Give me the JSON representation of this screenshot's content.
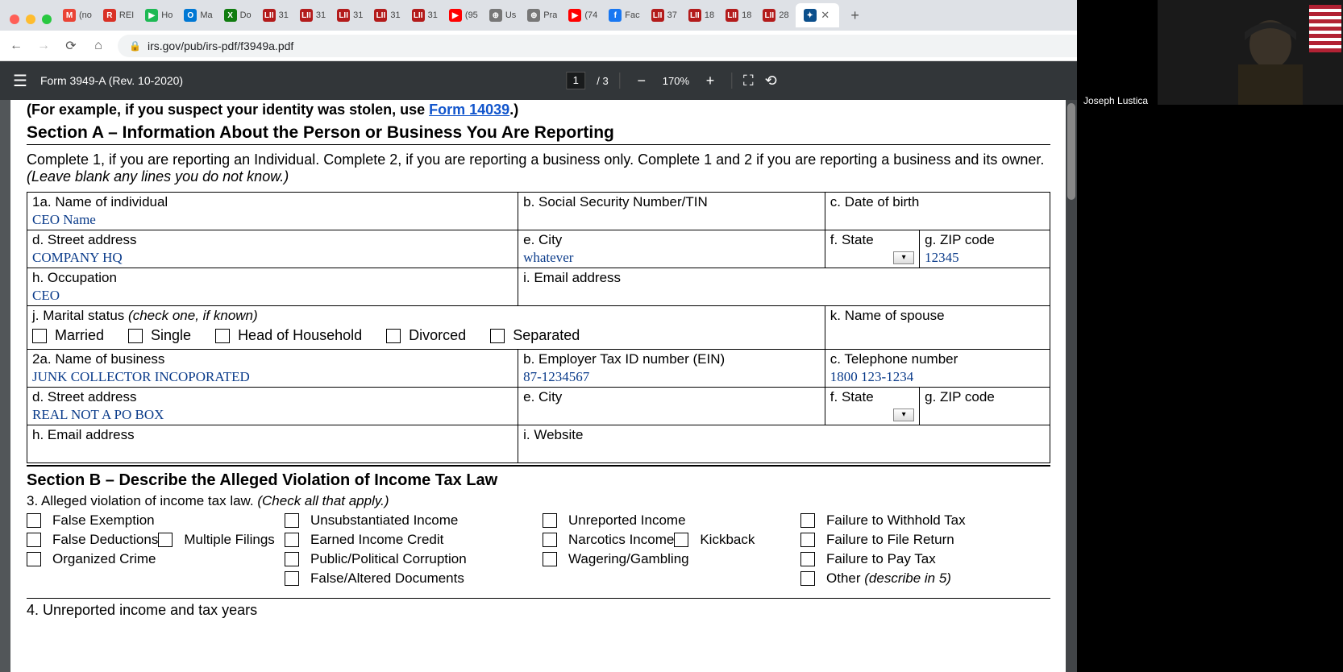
{
  "browser": {
    "tabs": [
      {
        "fav_bg": "#ea4335",
        "fav_txt": "M",
        "label": "(no"
      },
      {
        "fav_bg": "#d93025",
        "fav_txt": "R",
        "label": "REI"
      },
      {
        "fav_bg": "#1db954",
        "fav_txt": "▶",
        "label": "Ho"
      },
      {
        "fav_bg": "#0078d4",
        "fav_txt": "O",
        "label": "Ma"
      },
      {
        "fav_bg": "#107c10",
        "fav_txt": "X",
        "label": "Do"
      },
      {
        "fav_bg": "#b31b1b",
        "fav_txt": "LII",
        "label": "31"
      },
      {
        "fav_bg": "#b31b1b",
        "fav_txt": "LII",
        "label": "31"
      },
      {
        "fav_bg": "#b31b1b",
        "fav_txt": "LII",
        "label": "31"
      },
      {
        "fav_bg": "#b31b1b",
        "fav_txt": "LII",
        "label": "31"
      },
      {
        "fav_bg": "#b31b1b",
        "fav_txt": "LII",
        "label": "31"
      },
      {
        "fav_bg": "#ff0000",
        "fav_txt": "▶",
        "label": "(95"
      },
      {
        "fav_bg": "#777",
        "fav_txt": "⊕",
        "label": "Us"
      },
      {
        "fav_bg": "#777",
        "fav_txt": "⊕",
        "label": "Pra"
      },
      {
        "fav_bg": "#ff0000",
        "fav_txt": "▶",
        "label": "(74"
      },
      {
        "fav_bg": "#1877f2",
        "fav_txt": "f",
        "label": "Fac"
      },
      {
        "fav_bg": "#b31b1b",
        "fav_txt": "LII",
        "label": "37"
      },
      {
        "fav_bg": "#b31b1b",
        "fav_txt": "LII",
        "label": "18"
      },
      {
        "fav_bg": "#b31b1b",
        "fav_txt": "LII",
        "label": "18"
      },
      {
        "fav_bg": "#b31b1b",
        "fav_txt": "LII",
        "label": "28"
      }
    ],
    "active_tab": {
      "fav_bg": "#0b4f8c",
      "fav_txt": "✦",
      "label": ""
    },
    "url": "irs.gov/pub/irs-pdf/f3949a.pdf"
  },
  "pdf": {
    "title": "Form 3949-A (Rev. 10-2020)",
    "page_current": "1",
    "page_total": "3",
    "zoom": "170%"
  },
  "doc": {
    "example_prefix": "(For example, if you suspect your identity was stolen, use ",
    "example_link": "Form 14039",
    "example_suffix": ".)",
    "sectionA_title": "Section A – Information About the Person or Business You Are Reporting",
    "sectionA_instr1": "Complete 1, if you are reporting an Individual. Complete 2, if you are reporting a business only. Complete 1 and 2 if you are reporting a business and its owner.",
    "sectionA_instr2": "(Leave blank any lines you do not know.)",
    "labels": {
      "l1a": "1a. Name of individual",
      "l1b": "b. Social Security Number/TIN",
      "l1c": "c. Date of birth",
      "l1d": "d. Street address",
      "l1e": "e. City",
      "l1f": "f. State",
      "l1g": "g. ZIP code",
      "l1h": "h. Occupation",
      "l1i": "i. Email address",
      "l1j": "j. Marital status ",
      "l1j_hint": "(check one, if known)",
      "l1k": "k. Name of spouse",
      "l2a": "2a. Name of business",
      "l2b": "b. Employer Tax ID number (EIN)",
      "l2c": "c. Telephone number",
      "l2d": "d. Street address",
      "l2e": "e. City",
      "l2f": "f. State",
      "l2g": "g. ZIP code",
      "l2h": "h. Email address",
      "l2i": "i. Website"
    },
    "values": {
      "v1a": "CEO Name",
      "v1d": "COMPANY HQ",
      "v1e": "whatever",
      "v1g": "12345",
      "v1h": "CEO",
      "v2a": "JUNK COLLECTOR INCOPORATED",
      "v2b": "87-1234567",
      "v2c": "1800 123-1234",
      "v2d": "REAL NOT A PO BOX"
    },
    "marital": [
      "Married",
      "Single",
      "Head of Household",
      "Divorced",
      "Separated"
    ],
    "sectionB_title": "Section B – Describe the Alleged Violation of Income Tax Law",
    "q3_prefix": "3. Alleged violation of income tax law. ",
    "q3_hint": "(Check all that apply.)",
    "violations_col1": [
      "False Exemption",
      "False Deductions",
      "Multiple Filings",
      "Organized Crime"
    ],
    "violations_col2": [
      "Unsubstantiated Income",
      "Earned Income Credit",
      "Public/Political Corruption",
      "False/Altered Documents"
    ],
    "violations_col3": [
      "Unreported Income",
      "Narcotics Income",
      "Kickback",
      "Wagering/Gambling"
    ],
    "violations_col4": [
      "Failure to Withhold Tax",
      "Failure to File Return",
      "Failure to Pay Tax"
    ],
    "violation_other": "Other ",
    "violation_other_hint": "(describe in 5)",
    "q4": "4. Unreported income and tax years"
  },
  "video": {
    "name": "Joseph Lustica"
  }
}
